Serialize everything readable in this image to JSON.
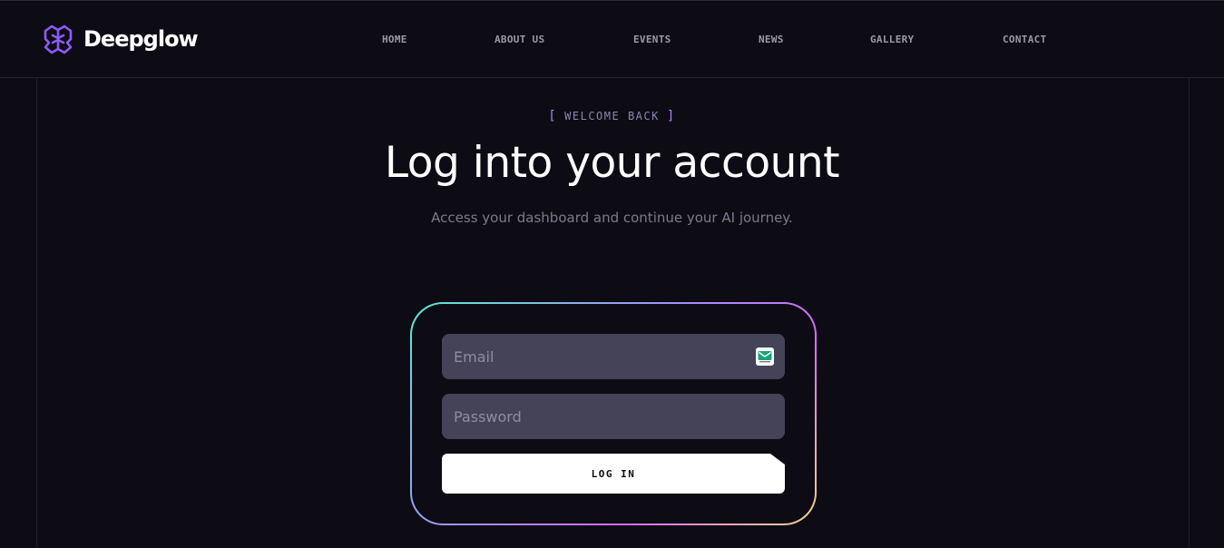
{
  "brand": {
    "name": "Deepglow",
    "logo_icon": "brain-icon",
    "accent": "#8b5cf6"
  },
  "nav": {
    "items": [
      {
        "label": "HOME"
      },
      {
        "label": "ABOUT US"
      },
      {
        "label": "EVENTS"
      },
      {
        "label": "NEWS"
      },
      {
        "label": "GALLERY"
      },
      {
        "label": "CONTACT"
      }
    ]
  },
  "hero": {
    "eyebrow_open": "[",
    "eyebrow": "WELCOME BACK",
    "eyebrow_close": "]",
    "title": "Log into your account",
    "subtitle": "Access your dashboard and continue your AI journey."
  },
  "form": {
    "email": {
      "placeholder": "Email",
      "value": "",
      "badge_icon": "email-autofill-icon"
    },
    "password": {
      "placeholder": "Password",
      "value": ""
    },
    "submit_label": "LOG IN"
  },
  "colors": {
    "background": "#0d0c14",
    "field": "#454358",
    "gradient": [
      "#5eead4",
      "#a78bfa",
      "#d36df2",
      "#f5d58a"
    ]
  }
}
